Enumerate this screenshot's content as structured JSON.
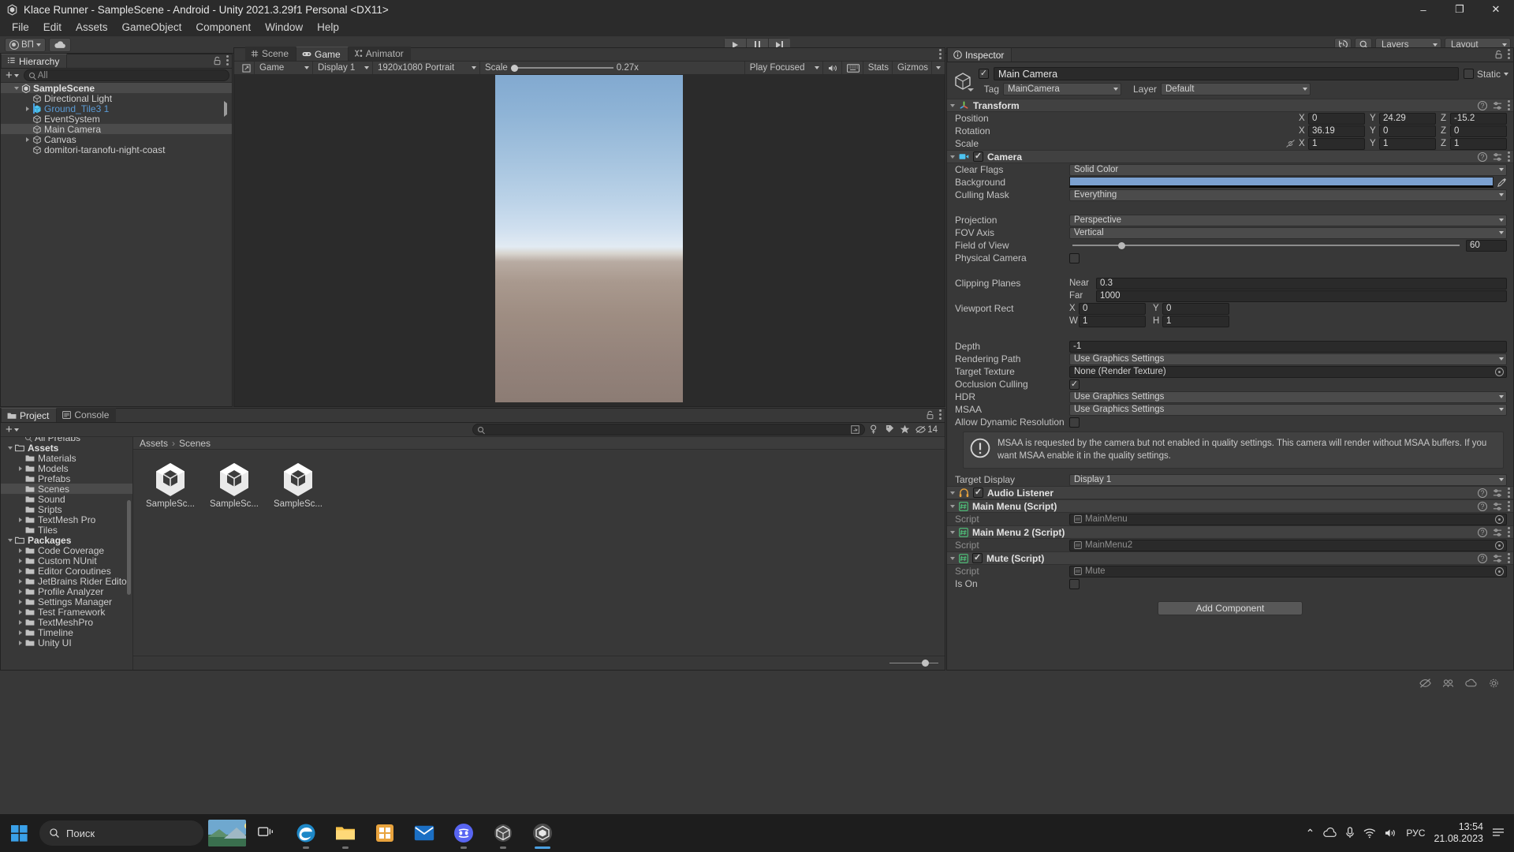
{
  "titlebar": {
    "title": "Klace Runner - SampleScene - Android - Unity 2021.3.29f1 Personal <DX11>",
    "minimize": "–",
    "maximize": "❐",
    "close": "✕"
  },
  "menubar": {
    "items": [
      "File",
      "Edit",
      "Assets",
      "GameObject",
      "Component",
      "Window",
      "Help"
    ]
  },
  "toolbar": {
    "account_label": "ВП",
    "play": "play-icon",
    "pause": "pause-icon",
    "step": "step-icon",
    "history_icon": "history-icon",
    "search_icon": "search-icon",
    "layers_label": "Layers",
    "layout_label": "Layout"
  },
  "hierarchy": {
    "tab": "Hierarchy",
    "search_placeholder": "All",
    "items": [
      {
        "label": "SampleScene",
        "depth": 0,
        "icon": "unity-scene-icon",
        "expanded": true,
        "selected": false,
        "scene": true
      },
      {
        "label": "Directional Light",
        "depth": 1,
        "icon": "gameobject-icon",
        "expanded": null,
        "selected": false
      },
      {
        "label": "Ground_Tile3 1",
        "depth": 1,
        "icon": "prefab-icon",
        "expanded": false,
        "selected": false,
        "blue": true,
        "marked": true,
        "submenu": true
      },
      {
        "label": "EventSystem",
        "depth": 1,
        "icon": "gameobject-icon",
        "expanded": null,
        "selected": false
      },
      {
        "label": "Main Camera",
        "depth": 1,
        "icon": "gameobject-icon",
        "expanded": null,
        "selected": true
      },
      {
        "label": "Canvas",
        "depth": 1,
        "icon": "gameobject-icon",
        "expanded": false,
        "selected": false
      },
      {
        "label": "domitori-taranofu-night-coast",
        "depth": 1,
        "icon": "gameobject-icon",
        "expanded": null,
        "selected": false
      }
    ]
  },
  "gameview": {
    "tabs": [
      {
        "label": "Scene",
        "icon": "scene-grid-icon",
        "active": false
      },
      {
        "label": "Game",
        "icon": "gamepad-icon",
        "active": true
      },
      {
        "label": "Animator",
        "icon": "animator-icon",
        "active": false
      }
    ],
    "toolbar": {
      "target": "Game",
      "display": "Display 1",
      "resolution": "1920x1080 Portrait",
      "scale_label": "Scale",
      "scale_value": "0.27x",
      "play_mode": "Play Focused",
      "mute_icon": "speaker-icon",
      "aspect_icon": "keyboard-icon",
      "stats": "Stats",
      "gizmos": "Gizmos"
    }
  },
  "inspector": {
    "tab": "Inspector",
    "object_name": "Main Camera",
    "enabled": true,
    "static_label": "Static",
    "tag_label": "Tag",
    "tag_value": "MainCamera",
    "layer_label": "Layer",
    "layer_value": "Default",
    "components": [
      {
        "name": "Transform",
        "icon": "transform-icon",
        "rows": [
          {
            "label": "Position",
            "type": "vector3",
            "x": "0",
            "y": "24.29",
            "z": "-15.2"
          },
          {
            "label": "Rotation",
            "type": "vector3",
            "x": "36.19",
            "y": "0",
            "z": "0"
          },
          {
            "label": "Scale",
            "type": "vector3",
            "x": "1",
            "y": "1",
            "z": "1",
            "link_icon": "constrain-off-icon"
          }
        ]
      },
      {
        "name": "Camera",
        "icon": "camera-icon",
        "enabled": true,
        "rows": [
          {
            "label": "Clear Flags",
            "type": "dropdown",
            "value": "Solid Color"
          },
          {
            "label": "Background",
            "type": "color",
            "value": "#7ba0d0"
          },
          {
            "label": "Culling Mask",
            "type": "dropdown",
            "value": "Everything"
          },
          {
            "label": "",
            "type": "spacer"
          },
          {
            "label": "Projection",
            "type": "dropdown",
            "value": "Perspective"
          },
          {
            "label": "FOV Axis",
            "type": "dropdown",
            "value": "Vertical"
          },
          {
            "label": "Field of View",
            "type": "slider",
            "value": "60"
          },
          {
            "label": "Physical Camera",
            "type": "checkbox",
            "checked": false
          },
          {
            "label": "",
            "type": "spacer"
          },
          {
            "label": "Clipping Planes",
            "type": "sublabeled",
            "sub1": "Near",
            "v1": "0.3",
            "sub2": "Far",
            "v2": "1000"
          },
          {
            "label": "Viewport Rect",
            "type": "rect",
            "x_label": "X",
            "x": "0",
            "y_label": "Y",
            "y": "0",
            "w_label": "W",
            "w": "1",
            "h_label": "H",
            "h": "1"
          },
          {
            "label": "",
            "type": "spacer"
          },
          {
            "label": "Depth",
            "type": "text",
            "value": "-1"
          },
          {
            "label": "Rendering Path",
            "type": "dropdown",
            "value": "Use Graphics Settings"
          },
          {
            "label": "Target Texture",
            "type": "objectfield",
            "value": "None (Render Texture)"
          },
          {
            "label": "Occlusion Culling",
            "type": "checkbox",
            "checked": true
          },
          {
            "label": "HDR",
            "type": "dropdown",
            "value": "Use Graphics Settings"
          },
          {
            "label": "MSAA",
            "type": "dropdown",
            "value": "Use Graphics Settings"
          },
          {
            "label": "Allow Dynamic Resolution",
            "type": "checkbox",
            "checked": false
          }
        ],
        "warning": "MSAA is requested by the camera but not enabled in quality settings. This camera will render without MSAA buffers. If you want MSAA enable it in the quality settings.",
        "after_warning": {
          "label": "Target Display",
          "type": "dropdown",
          "value": "Display 1"
        }
      },
      {
        "name": "Audio Listener",
        "icon": "audio-listener-icon",
        "enabled": true,
        "rows": []
      },
      {
        "name": "Main Menu (Script)",
        "icon": "script-icon",
        "enabled": null,
        "rows": [
          {
            "label": "Script",
            "type": "scriptfield",
            "value": "MainMenu"
          }
        ]
      },
      {
        "name": "Main Menu 2 (Script)",
        "icon": "script-icon",
        "enabled": null,
        "rows": [
          {
            "label": "Script",
            "type": "scriptfield",
            "value": "MainMenu2"
          }
        ]
      },
      {
        "name": "Mute (Script)",
        "icon": "script-icon",
        "enabled": true,
        "rows": [
          {
            "label": "Script",
            "type": "scriptfield",
            "value": "Mute"
          },
          {
            "label": "Is On",
            "type": "checkbox",
            "checked": false
          }
        ]
      }
    ],
    "add_component": "Add Component"
  },
  "project": {
    "tabs": [
      {
        "label": "Project",
        "icon": "folder-icon",
        "active": true
      },
      {
        "label": "Console",
        "icon": "console-icon",
        "active": false
      }
    ],
    "tree": [
      {
        "label": "All Prefabs",
        "depth": 1,
        "type": "search",
        "partial": true
      },
      {
        "label": "Assets",
        "depth": 0,
        "type": "folder",
        "expanded": true,
        "bold": true
      },
      {
        "label": "Materials",
        "depth": 1,
        "type": "folder"
      },
      {
        "label": "Models",
        "depth": 1,
        "type": "folder",
        "expanded": false
      },
      {
        "label": "Prefabs",
        "depth": 1,
        "type": "folder"
      },
      {
        "label": "Scenes",
        "depth": 1,
        "type": "folder",
        "selected": true
      },
      {
        "label": "Sound",
        "depth": 1,
        "type": "folder"
      },
      {
        "label": "Sripts",
        "depth": 1,
        "type": "folder"
      },
      {
        "label": "TextMesh Pro",
        "depth": 1,
        "type": "folder",
        "expanded": false
      },
      {
        "label": "Tiles",
        "depth": 1,
        "type": "folder"
      },
      {
        "label": "Packages",
        "depth": 0,
        "type": "folder",
        "expanded": true,
        "bold": true
      },
      {
        "label": "Code Coverage",
        "depth": 1,
        "type": "folder",
        "expanded": false
      },
      {
        "label": "Custom NUnit",
        "depth": 1,
        "type": "folder",
        "expanded": false
      },
      {
        "label": "Editor Coroutines",
        "depth": 1,
        "type": "folder",
        "expanded": false
      },
      {
        "label": "JetBrains Rider Editor",
        "depth": 1,
        "type": "folder",
        "expanded": false
      },
      {
        "label": "Profile Analyzer",
        "depth": 1,
        "type": "folder",
        "expanded": false
      },
      {
        "label": "Settings Manager",
        "depth": 1,
        "type": "folder",
        "expanded": false
      },
      {
        "label": "Test Framework",
        "depth": 1,
        "type": "folder",
        "expanded": false
      },
      {
        "label": "TextMeshPro",
        "depth": 1,
        "type": "folder",
        "expanded": false
      },
      {
        "label": "Timeline",
        "depth": 1,
        "type": "folder",
        "expanded": false
      },
      {
        "label": "Unity UI",
        "depth": 1,
        "type": "folder",
        "expanded": false
      }
    ],
    "breadcrumb": [
      "Assets",
      "Scenes"
    ],
    "assets": [
      {
        "label": "SampleSc...",
        "icon": "unity-scene-asset-icon"
      },
      {
        "label": "SampleSc...",
        "icon": "unity-scene-asset-icon"
      },
      {
        "label": "SampleSc...",
        "icon": "unity-scene-asset-icon"
      }
    ],
    "hidden_count": "14",
    "search_placeholder": ""
  },
  "taskbar": {
    "search_placeholder": "Поиск",
    "apps": [
      {
        "name": "weather-widget",
        "label": ""
      },
      {
        "name": "task-view-icon"
      },
      {
        "name": "edge-icon",
        "running": true
      },
      {
        "name": "file-explorer-icon",
        "running": true
      },
      {
        "name": "store-icon"
      },
      {
        "name": "mail-icon"
      },
      {
        "name": "discord-icon",
        "running": true
      },
      {
        "name": "blender-icon",
        "running": true
      },
      {
        "name": "unity-icon",
        "active": true
      }
    ],
    "tray": {
      "time": "13:54",
      "date": "21.08.2023",
      "lang": "РУС",
      "chevron": "⌃"
    }
  }
}
